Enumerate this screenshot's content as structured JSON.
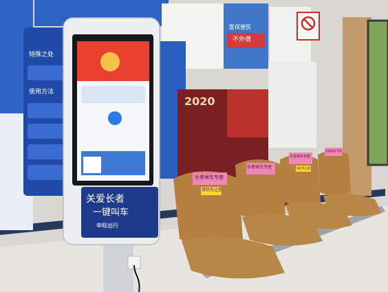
{
  "kiosk": {
    "banner_line1": "关爱长者",
    "banner_line2": "一键叫车",
    "brand_label": "申程出行"
  },
  "seat_signs": [
    {
      "line1": "长者候车专座",
      "line2": "请优先让座"
    },
    {
      "line1": "长者候车专座",
      "line2": ""
    },
    {
      "line1": "长者候车专座",
      "line2": "请优先让座"
    },
    {
      "line1": "长者候车专座",
      "line2": ""
    }
  ],
  "posters": {
    "left_panel_title": "特殊之处",
    "left_panel_subtitle": "使用方法",
    "ad_line1": "医保便民",
    "ad_line2": "不外借",
    "red_poster_year": "2020"
  },
  "colors": {
    "kiosk_navy": "#1e3a8a",
    "seat_tan": "#b5803f",
    "sign_pink": "#ee86b6",
    "wall": "#d8d8d3"
  }
}
